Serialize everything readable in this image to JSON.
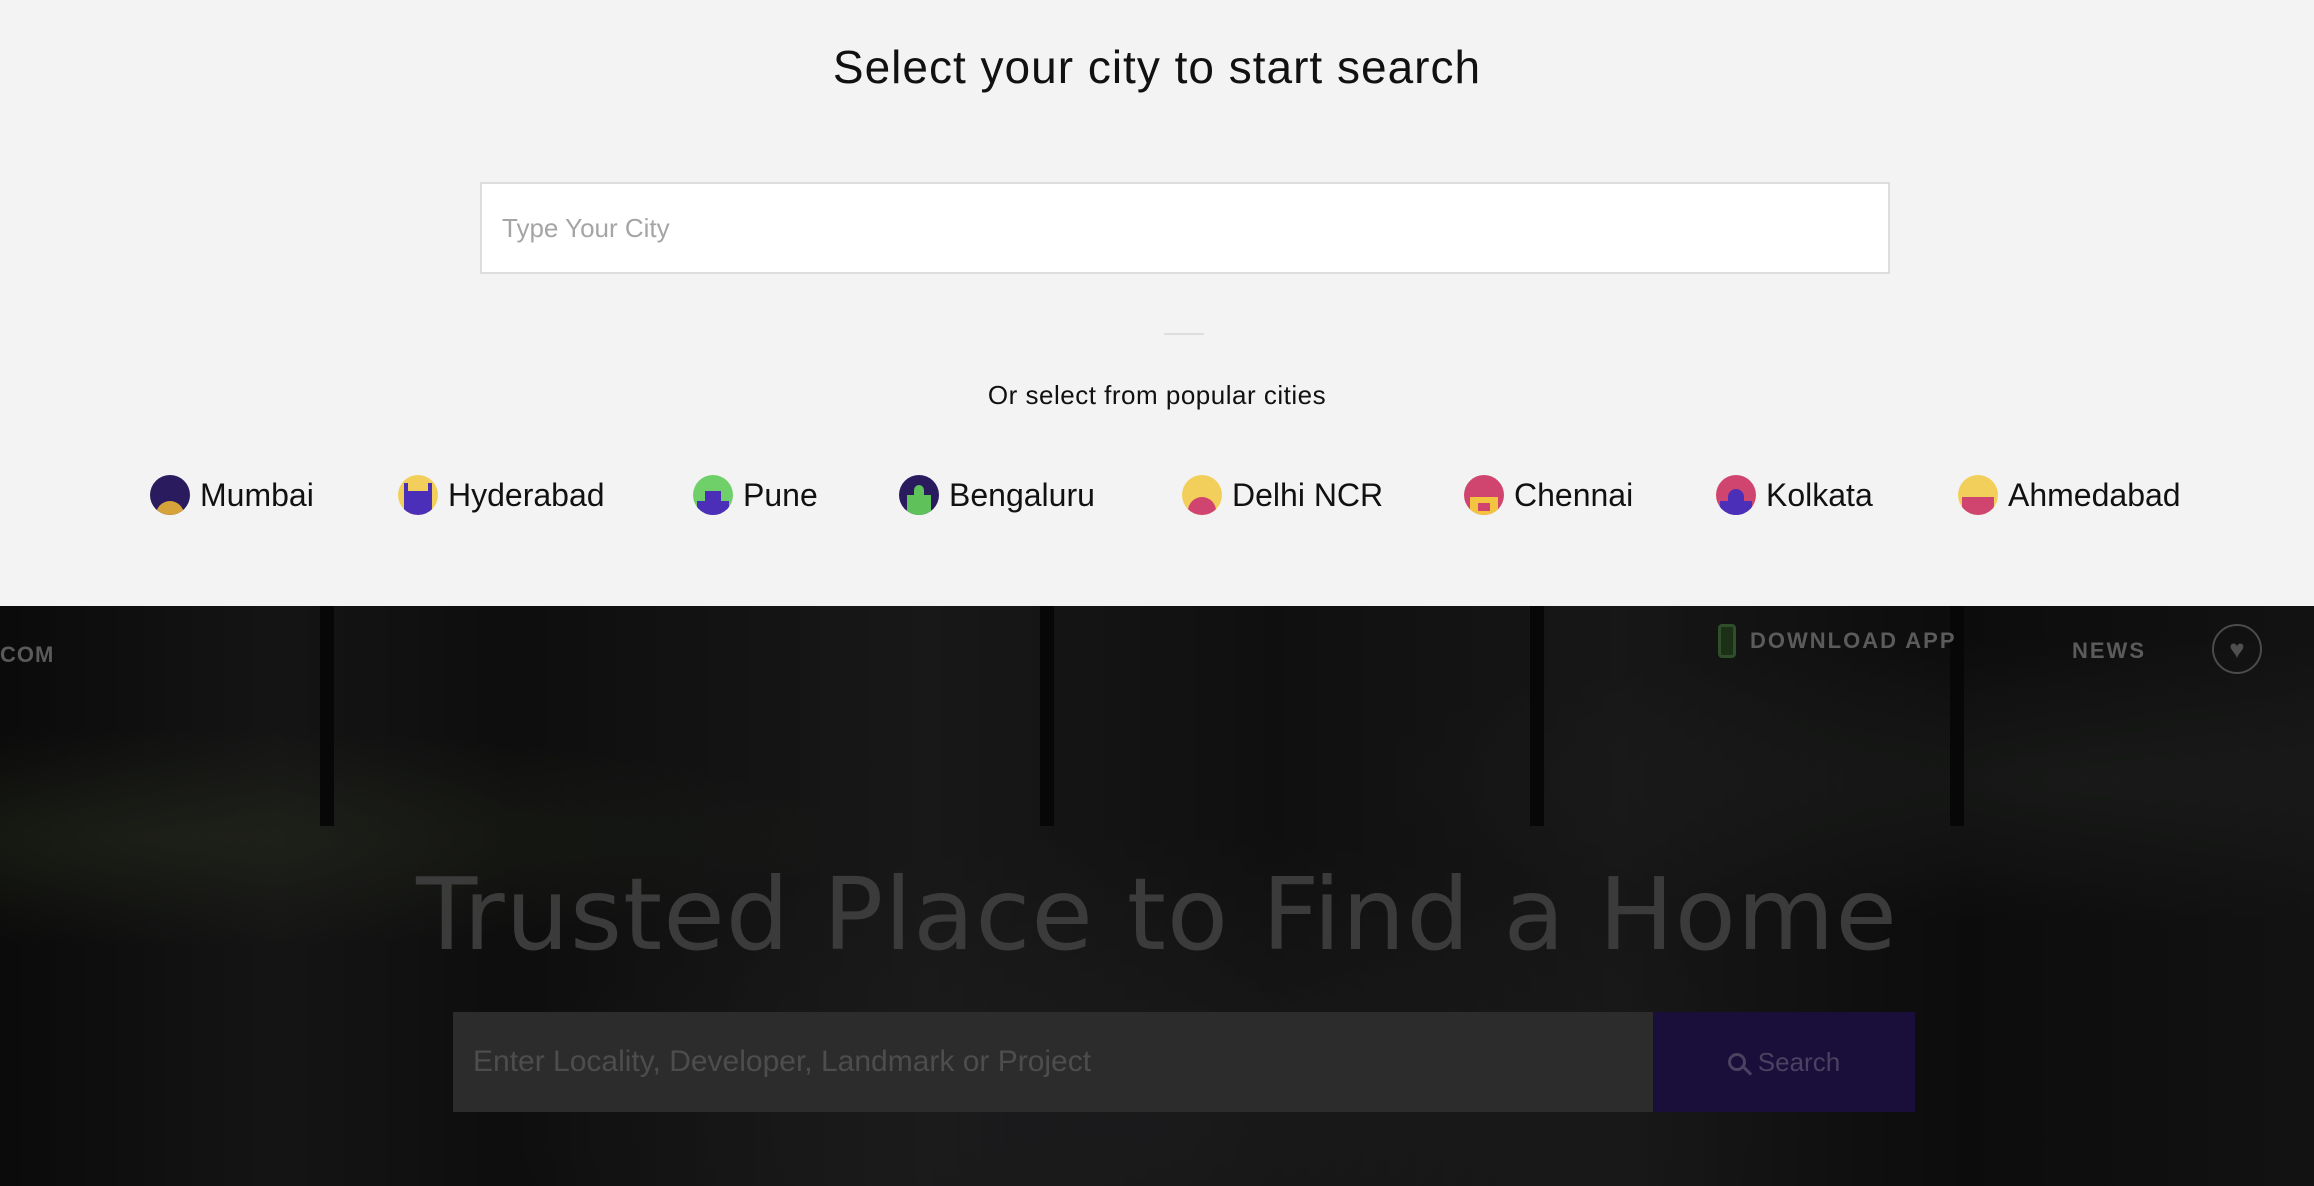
{
  "picker": {
    "title": "Select your city to start search",
    "input_placeholder": "Type Your City",
    "popular_label": "Or select from popular cities",
    "cities": [
      {
        "name": "Mumbai",
        "icon": "gateway-of-india-icon",
        "sky": "#2a1a5e",
        "building": "#d6a23a"
      },
      {
        "name": "Hyderabad",
        "icon": "charminar-icon",
        "sky": "#f2cf5a",
        "building": "#4b2fb8"
      },
      {
        "name": "Pune",
        "icon": "shaniwar-wada-icon",
        "sky": "#6fd06a",
        "building": "#4b2fb8"
      },
      {
        "name": "Bengaluru",
        "icon": "vidhana-soudha-icon",
        "sky": "#2a1a5e",
        "building": "#5fc15a"
      },
      {
        "name": "Delhi NCR",
        "icon": "india-gate-icon",
        "sky": "#f2cf5a",
        "building": "#d0456f"
      },
      {
        "name": "Chennai",
        "icon": "chennai-monument-icon",
        "sky": "#d0456f",
        "building": "#f2c440"
      },
      {
        "name": "Kolkata",
        "icon": "victoria-memorial-icon",
        "sky": "#d0456f",
        "building": "#4b2fb8"
      },
      {
        "name": "Ahmedabad",
        "icon": "ahmedabad-monument-icon",
        "sky": "#f2cf5a",
        "building": "#d0456f"
      }
    ]
  },
  "hero": {
    "brand_fragment": "COM",
    "download_app": "DOWNLOAD APP",
    "news": "NEWS",
    "title": "Trusted Place to Find a Home",
    "search_placeholder": "Enter Locality, Developer, Landmark or Project",
    "search_button": "Search"
  },
  "colors": {
    "picker_bg": "#f3f3f3",
    "search_button_bg": "#1a0e3a"
  }
}
